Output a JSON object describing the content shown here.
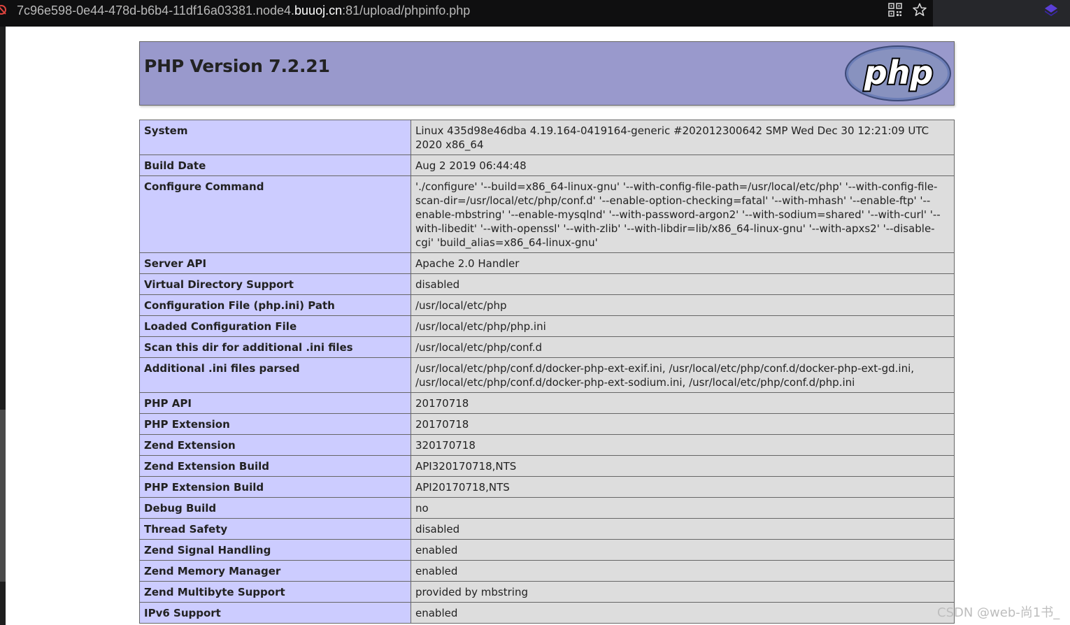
{
  "browser": {
    "url_prefix": "7c96e598-0e44-478d-b6b4-11df16a03381.node4.",
    "url_domain": "buuoj.cn",
    "url_suffix": ":81/upload/phpinfo.php"
  },
  "header": {
    "title": "PHP Version 7.2.21",
    "logo_text": "php"
  },
  "rows": [
    {
      "key": "System",
      "value": "Linux 435d98e46dba 4.19.164-0419164-generic #202012300642 SMP Wed Dec 30 12:21:09 UTC 2020 x86_64"
    },
    {
      "key": "Build Date",
      "value": "Aug 2 2019 06:44:48"
    },
    {
      "key": "Configure Command",
      "value": "'./configure' '--build=x86_64-linux-gnu' '--with-config-file-path=/usr/local/etc/php' '--with-config-file-scan-dir=/usr/local/etc/php/conf.d' '--enable-option-checking=fatal' '--with-mhash' '--enable-ftp' '--enable-mbstring' '--enable-mysqlnd' '--with-password-argon2' '--with-sodium=shared' '--with-curl' '--with-libedit' '--with-openssl' '--with-zlib' '--with-libdir=lib/x86_64-linux-gnu' '--with-apxs2' '--disable-cgi' 'build_alias=x86_64-linux-gnu'"
    },
    {
      "key": "Server API",
      "value": "Apache 2.0 Handler"
    },
    {
      "key": "Virtual Directory Support",
      "value": "disabled"
    },
    {
      "key": "Configuration File (php.ini) Path",
      "value": "/usr/local/etc/php"
    },
    {
      "key": "Loaded Configuration File",
      "value": "/usr/local/etc/php/php.ini"
    },
    {
      "key": "Scan this dir for additional .ini files",
      "value": "/usr/local/etc/php/conf.d"
    },
    {
      "key": "Additional .ini files parsed",
      "value": "/usr/local/etc/php/conf.d/docker-php-ext-exif.ini, /usr/local/etc/php/conf.d/docker-php-ext-gd.ini, /usr/local/etc/php/conf.d/docker-php-ext-sodium.ini, /usr/local/etc/php/conf.d/php.ini"
    },
    {
      "key": "PHP API",
      "value": "20170718"
    },
    {
      "key": "PHP Extension",
      "value": "20170718"
    },
    {
      "key": "Zend Extension",
      "value": "320170718"
    },
    {
      "key": "Zend Extension Build",
      "value": "API320170718,NTS"
    },
    {
      "key": "PHP Extension Build",
      "value": "API20170718,NTS"
    },
    {
      "key": "Debug Build",
      "value": "no"
    },
    {
      "key": "Thread Safety",
      "value": "disabled"
    },
    {
      "key": "Zend Signal Handling",
      "value": "enabled"
    },
    {
      "key": "Zend Memory Manager",
      "value": "enabled"
    },
    {
      "key": "Zend Multibyte Support",
      "value": "provided by mbstring"
    },
    {
      "key": "IPv6 Support",
      "value": "enabled"
    }
  ],
  "watermark": "CSDN @web-尚1书_",
  "icons": {
    "insecure": "insecure-lock-icon",
    "qr": "qr-code-icon",
    "bookmark": "star-icon",
    "extension": "extension-icon"
  },
  "colors": {
    "header_bg": "#9999cc",
    "key_cell_bg": "#ccccff",
    "value_cell_bg": "#dddddd",
    "border": "#666666"
  }
}
